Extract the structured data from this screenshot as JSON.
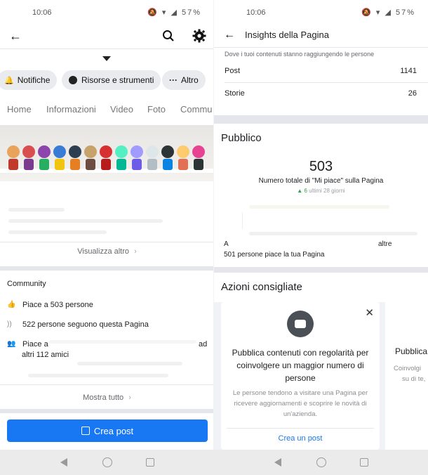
{
  "left": {
    "status": {
      "time": "10:06",
      "icons": "57%"
    },
    "chips": [
      "Notifiche",
      "Risorse e strumenti",
      "Altro"
    ],
    "tabs": [
      "Home",
      "Informazioni",
      "Video",
      "Foto",
      "Commu"
    ],
    "visualizza_altro": "Visualizza altro",
    "community": {
      "title": "Community",
      "likes": "Piace a 503 persone",
      "followers": "522 persone seguono questa Pagina",
      "friends_a": "Piace a",
      "friends_ad": "ad",
      "friends_b": "altri 112 amici"
    },
    "mostra_tutto": "Mostra tutto",
    "crea_post": "Crea post"
  },
  "right": {
    "status": {
      "time": "10:06",
      "icons": "57%"
    },
    "title": "Insights della Pagina",
    "subtitle": "Dove i tuoi contenuti stanno raggiungendo le persone",
    "post_label": "Post",
    "post_value": "1141",
    "storie_label": "Storie",
    "storie_value": "26",
    "pubblico": {
      "heading": "Pubblico",
      "total": "503",
      "caption": "Numero totale di \"Mi piace\" sulla Pagina",
      "trend_arrow": "▲",
      "trend_value": "6",
      "trend_label": "ultimi 28 giorni",
      "friends_a": "A",
      "friends_b": "altre",
      "friends_line": "501 persone piace la tua Pagina"
    },
    "azioni": {
      "heading": "Azioni consigliate",
      "card_title": "Pubblica contenuti con regolarità per coinvolgere un maggior numero di persone",
      "card_desc": "Le persone tendono a visitare una Pagina per ricevere aggiornamenti e scoprire le novità di un'azienda.",
      "card_link": "Crea un post",
      "card2_title": "Pubblica",
      "card2_desc_1": "Coinvolgi",
      "card2_desc_2": "su di te,"
    }
  },
  "colors": {
    "brand_blue": "#1877f2",
    "gray_chip": "#e9ebee",
    "divider": "#e4e6eb",
    "trend_green": "#31a24c"
  },
  "icons": [
    "back-arrow-icon",
    "search-icon",
    "gear-icon",
    "bell-icon",
    "info-icon",
    "more-dots-icon",
    "thumbs-up-icon",
    "rss-icon",
    "friends-icon",
    "edit-icon",
    "close-icon",
    "message-bubble-icon",
    "chevron-right-icon",
    "wifi-icon",
    "battery-icon"
  ]
}
